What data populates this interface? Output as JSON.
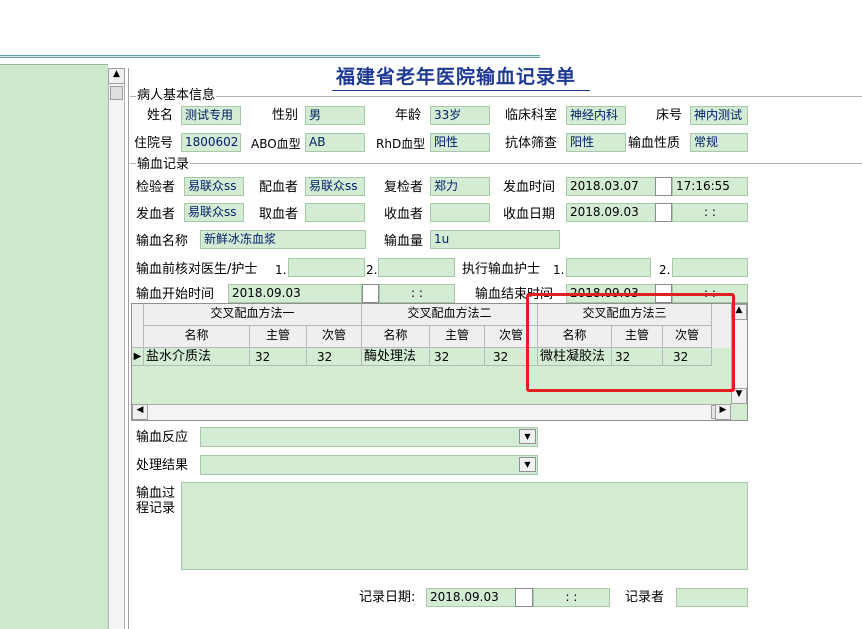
{
  "form_title": "福建省老年医院输血记录单",
  "patient_section": {
    "title": "病人基本信息",
    "name_label": "姓名",
    "name": "测试专用",
    "sex_label": "性别",
    "sex": "男",
    "age_label": "年龄",
    "age": "33岁",
    "dept_label": "临床科室",
    "dept": "神经内科",
    "bed_label": "床号",
    "bed": "神内测试",
    "admission_label": "住院号",
    "admission": "1800602",
    "abo_label": "ABO血型",
    "abo": "AB",
    "rhd_label": "RhD血型",
    "rhd": "阳性",
    "antibody_label": "抗体筛查",
    "antibody": "阳性",
    "nature_label": "输血性质",
    "nature": "常规"
  },
  "record_section": {
    "title": "输血记录",
    "inspector_label": "检验者",
    "inspector": "易联众ss",
    "matcher_label": "配血者",
    "matcher": "易联众ss",
    "rechecker_label": "复检者",
    "rechecker": "郑力",
    "issue_time_label": "发血时间",
    "issue_date": "2018.03.07",
    "issue_time": "17:16:55",
    "issuer_label": "发血者",
    "issuer": "易联众ss",
    "taker_label": "取血者",
    "taker": "",
    "receiver_label": "收血者",
    "receiver": "",
    "receive_date_label": "收血日期",
    "receive_date": "2018.09.03",
    "receive_time": ":   :",
    "blood_name_label": "输血名称",
    "blood_name": "新鲜冰冻血浆",
    "blood_amount_label": "输血量",
    "blood_amount": "1u",
    "precheck_label": "输血前核对医生/护士",
    "precheck_1": "1.",
    "precheck_2": "2.",
    "exec_nurse_label": "执行输血护士",
    "exec_1": "1.",
    "exec_2": "2.",
    "start_time_label": "输血开始时间",
    "start_date": "2018.09.03",
    "start_time": ":   :",
    "end_time_label": "输血结束时间",
    "end_date": "2018.09.03",
    "end_time": ":   :"
  },
  "grid": {
    "groups": [
      "交叉配血方法一",
      "交叉配血方法二",
      "交叉配血方法三"
    ],
    "col_name": "名称",
    "col_main": "主管",
    "col_minor": "次管",
    "row": {
      "m1_name": "盐水介质法",
      "m1_main": "32",
      "m1_minor": "32",
      "m2_name": "酶处理法",
      "m2_main": "32",
      "m2_minor": "32",
      "m3_name": "微柱凝胶法",
      "m3_main": "32",
      "m3_minor": "32"
    },
    "row_indicator": "▶"
  },
  "reaction_label": "输血反应",
  "result_label": "处理结果",
  "process_label_1": "输血过",
  "process_label_2": "程记录",
  "record_date_label": "记录日期:",
  "record_date": "2018.09.03",
  "record_time": ":   :",
  "recorder_label": "记录者",
  "colors": {
    "field_bg": "#d4ecd4",
    "highlight": "#e02020",
    "left_panel": "#cde9cd",
    "title_blue": "#1f3a93"
  }
}
